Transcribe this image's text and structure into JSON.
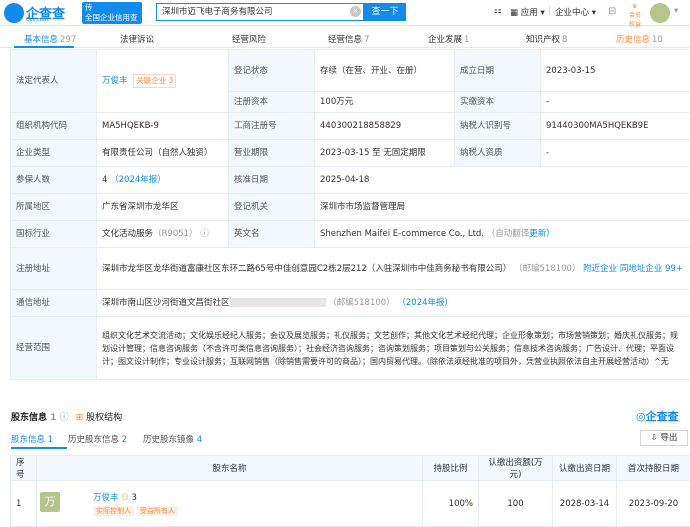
{
  "topbar": {
    "logo_text": "企查查",
    "logo_sub": "Qcc.com",
    "badge_line1": "传",
    "badge_line2": "全国企业信用查询",
    "search_value": "深圳市迈飞电子商务有限公司",
    "search_button": "查一下",
    "apps": "应用",
    "enterprise_center": "企业中心",
    "member_label1": "会员",
    "member_label2": "权益"
  },
  "tabs": [
    {
      "label": "基本信息",
      "count": "297"
    },
    {
      "label": "法律诉讼",
      "count": ""
    },
    {
      "label": "经营风险",
      "count": ""
    },
    {
      "label": "经营信息",
      "count": "7"
    },
    {
      "label": "企业发展",
      "count": "1"
    },
    {
      "label": "知识产权",
      "count": "8"
    },
    {
      "label": "历史信息",
      "count": "10"
    }
  ],
  "info": {
    "legal_rep_label": "法定代表人",
    "legal_rep": "万俊丰",
    "related_company_label": "关联企业",
    "related_company_count": "3",
    "reg_status_label": "登记状态",
    "reg_status": "存续（在营、开业、在册）",
    "established_label": "成立日期",
    "established": "2023-03-15",
    "reg_capital_label": "注册资本",
    "reg_capital": "100万元",
    "paid_capital_label": "实缴资本",
    "paid_capital": "-",
    "org_code_label": "组织机构代码",
    "org_code": "MA5HQEKB-9",
    "biz_reg_no_label": "工商注册号",
    "biz_reg_no": "440300218858829",
    "taxpayer_id_label": "纳税人识别号",
    "taxpayer_id": "91440300MA5HQEKB9E",
    "company_type_label": "企业类型",
    "company_type": "有限责任公司（自然人独资）",
    "biz_term_label": "营业期限",
    "biz_term": "2023-03-15 至 无固定期限",
    "taxpayer_qual_label": "纳税人资质",
    "taxpayer_qual": "-",
    "insured_label": "参保人数",
    "insured": "4",
    "insured_year": "（2024年报）",
    "approval_date_label": "核准日期",
    "approval_date": "2025-04-18",
    "region_label": "所属地区",
    "region": "广东省深圳市龙华区",
    "authority_label": "登记机关",
    "authority": "深圳市市场监督管理局",
    "industry_label": "国标行业",
    "industry": "文化活动服务",
    "industry_code": "（R9051）",
    "english_name_label": "英文名",
    "english_name": "Shenzhen Maifei E-commerce Co., Ltd.",
    "english_name_note": "（自动翻译",
    "more": "更新）",
    "reg_address_label": "注册地址",
    "reg_address": "深圳市龙华区龙华街道富康社区东环二路65号中佳创意园C2栋2层212（入驻深圳市中佳商务秘书有限公司）",
    "reg_address_postcode": "（邮编518100）",
    "nearby": "附近企业",
    "same_address": "同地址企业 99+",
    "comm_address_label": "通信地址",
    "comm_address": "深圳市南山区沙河街道文昌街社区",
    "comm_postcode": "（邮编518100）",
    "comm_year": "（2024年报）",
    "scope_label": "经营范围",
    "scope": "组织文化艺术交流活动；文化娱乐经纪人服务；会议及展览服务；礼仪服务；文艺创作；其他文化艺术经纪代理；企业形象策划；市场营销策划；婚庆礼仪服务；规划设计管理；信息咨询服务（不含许可类信息咨询服务）；社会经济咨询服务；咨询策划服务；项目策划与公关服务；信息技术咨询服务；广告设计、代理；平面设计；图文设计制作；专业设计服务；互联网销售（除销售需要许可的商品）；国内贸易代理。（除依法须经批准的项目外，凭营业执照依法自主开展经营活动）^无"
  },
  "shareholders": {
    "title": "股东信息",
    "count": "1",
    "equity_structure": "股权结构",
    "brand": "企查查",
    "subtabs": [
      {
        "label": "股东信息",
        "count": "1"
      },
      {
        "label": "历史股东信息",
        "count": "2"
      },
      {
        "label": "历史股东镜像",
        "count": "4"
      }
    ],
    "export": "导出",
    "headers": [
      "序号",
      "股东名称",
      "持股比例",
      "认缴出资额(万元)",
      "认缴出资日期",
      "首次持股日期"
    ],
    "row": {
      "index": "1",
      "avatar": "万",
      "name": "万俊丰",
      "related_count": "3",
      "tag1": "实际控制人",
      "tag2": "受益所有人",
      "ratio": "100%",
      "amount": "100",
      "date": "2028-03-14",
      "first_date": "2023-09-20"
    }
  }
}
